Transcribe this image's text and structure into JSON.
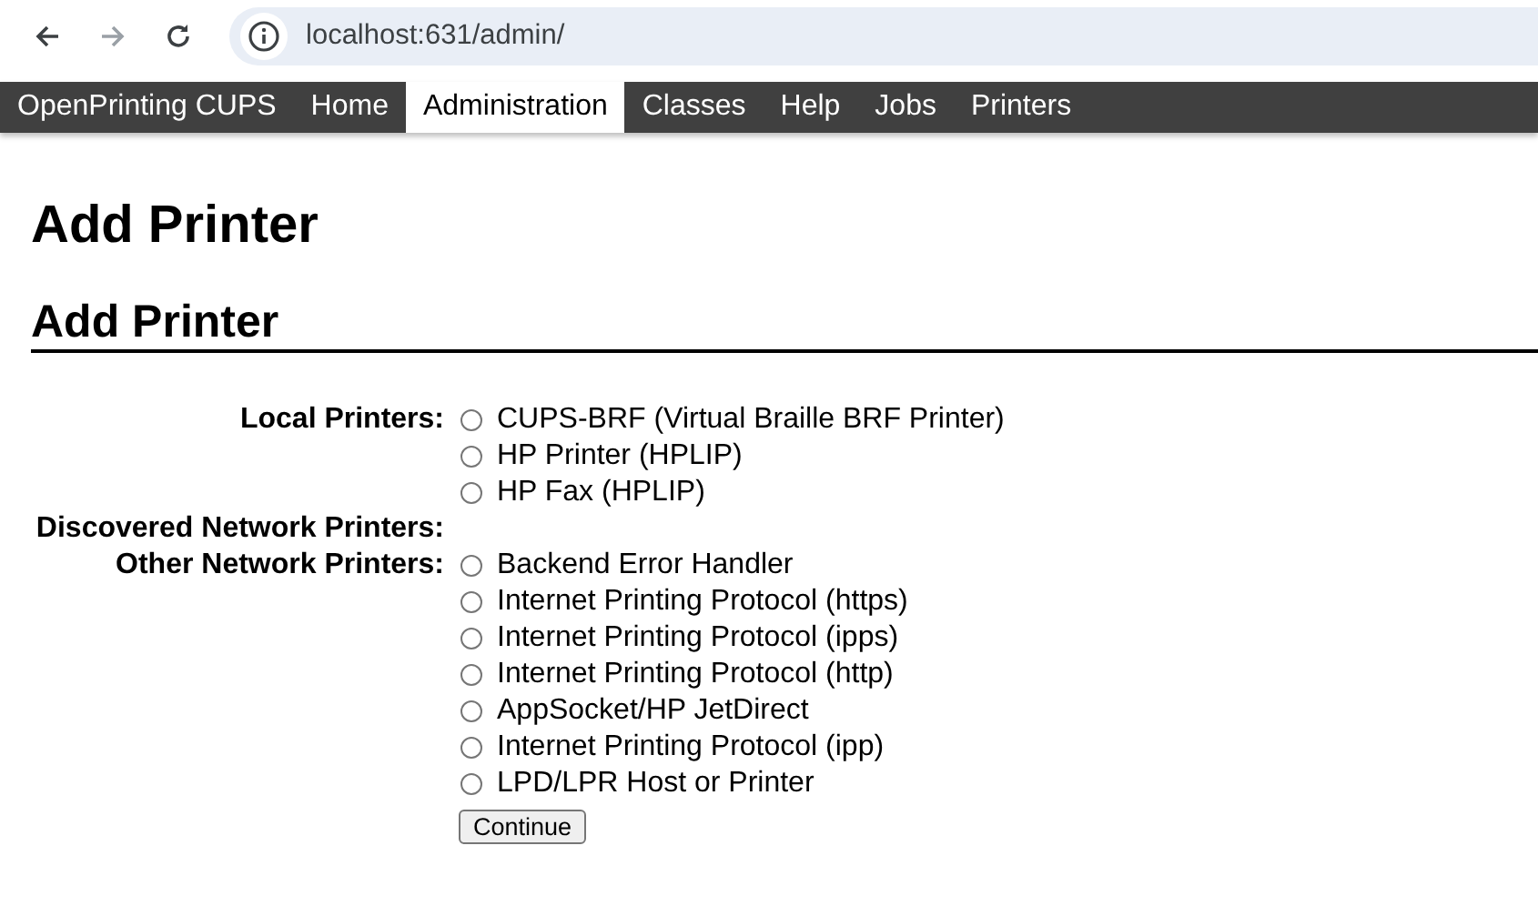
{
  "browser": {
    "url": "localhost:631/admin/",
    "forward_disabled": true
  },
  "nav": [
    {
      "label": "OpenPrinting CUPS",
      "selected": false
    },
    {
      "label": "Home",
      "selected": false
    },
    {
      "label": "Administration",
      "selected": true
    },
    {
      "label": "Classes",
      "selected": false
    },
    {
      "label": "Help",
      "selected": false
    },
    {
      "label": "Jobs",
      "selected": false
    },
    {
      "label": "Printers",
      "selected": false
    }
  ],
  "page_title": "Add Printer",
  "section_title": "Add Printer",
  "groups": [
    {
      "label": "Local Printers:",
      "options": [
        {
          "label": "CUPS-BRF (Virtual Braille BRF Printer)",
          "selected": false
        },
        {
          "label": "HP Printer (HPLIP)",
          "selected": false
        },
        {
          "label": "HP Fax (HPLIP)",
          "selected": false
        }
      ]
    },
    {
      "label": "Discovered Network Printers:"
    },
    {
      "label": "Other Network Printers:",
      "options": [
        {
          "label": "Backend Error Handler",
          "selected": false
        },
        {
          "label": "Internet Printing Protocol (https)",
          "selected": false
        },
        {
          "label": "Internet Printing Protocol (ipps)",
          "selected": false
        },
        {
          "label": "Internet Printing Protocol (http)",
          "selected": false
        },
        {
          "label": "AppSocket/HP JetDirect",
          "selected": false
        },
        {
          "label": "Internet Printing Protocol (ipp)",
          "selected": false
        },
        {
          "label": "LPD/LPR Host or Printer",
          "selected": false
        }
      ]
    }
  ],
  "submit_button": "Continue"
}
